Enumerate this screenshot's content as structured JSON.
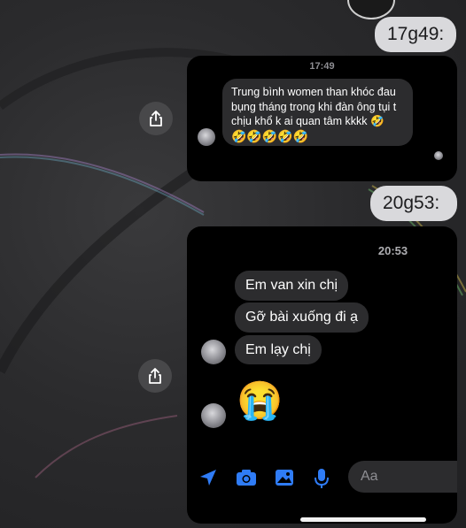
{
  "timestamps": {
    "first": "17g49:",
    "second": "20g53:"
  },
  "card1": {
    "time": "17:49",
    "message": "Trung bình women than khóc đau bụng tháng trong khi đàn ông tụi t chịu khổ k ai quan tâm kkkk 🤣",
    "emoji_line": "🤣🤣🤣🤣🤣"
  },
  "card2": {
    "time": "20:53",
    "messages": [
      "Em van xin chị",
      "Gỡ bài xuống đi ạ",
      "Em lạy chị"
    ],
    "emoji": "😭",
    "input_placeholder": "Aa"
  },
  "colors": {
    "accent": "#2f7cf6",
    "bubble": "#2c2c2e",
    "card": "#000000",
    "timestamp_bubble": "#d9d9dc"
  },
  "icons": [
    "share-icon",
    "send-location-icon",
    "camera-icon",
    "image-icon",
    "microphone-icon"
  ]
}
